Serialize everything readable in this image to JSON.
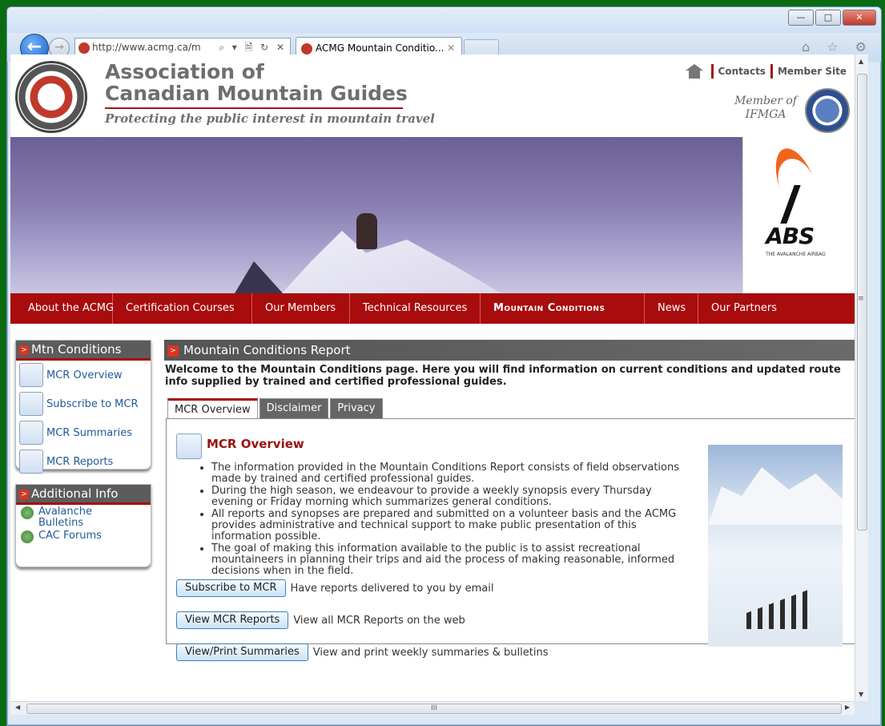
{
  "browser": {
    "address": "http://www.acmg.ca/m",
    "address_domain": "acmg.ca",
    "address_tools": "⌕ ▾ 🗎 ↻ ✕",
    "tab_title": "ACMG Mountain Conditio...",
    "tab_close": "✕",
    "win_min": "—",
    "win_max": "□",
    "win_close": "✕",
    "back": "←",
    "forward": "→",
    "ie_icons": "⌂ ☆ ⚙"
  },
  "header": {
    "org_line1": "Association of",
    "org_line2": "Canadian Mountain Guides",
    "tagline": "Protecting the public interest in mountain travel",
    "contacts": "Contacts",
    "member_site": "Member Site",
    "member_of_line1": "Member of",
    "member_of_line2": "IFMGA"
  },
  "ad": {
    "brand": "ABS",
    "sub": "THE AVALANCHE AIRBAG"
  },
  "nav": {
    "items": [
      "About the ACMG",
      "Certification Courses",
      "Our Members",
      "Technical Resources",
      "Mountain Conditions",
      "News",
      "Our Partners"
    ],
    "active_index": 4
  },
  "sidebar": {
    "mtn_head": "Mtn Conditions",
    "mtn_items": [
      "MCR Overview",
      "Subscribe to MCR",
      "MCR Summaries",
      "MCR Reports"
    ],
    "info_head": "Additional Info",
    "info_items": [
      "Avalanche Bulletins",
      "CAC Forums"
    ]
  },
  "main": {
    "panel_title": "Mountain Conditions Report",
    "welcome": "Welcome to the Mountain Conditions page. Here you will find information on current conditions and updated route info supplied by trained and certified professional guides.",
    "tabs": [
      "MCR Overview",
      "Disclaimer",
      "Privacy"
    ],
    "overview_title": "MCR Overview",
    "bullets": [
      "The information provided in the Mountain Conditions Report consists of field observations made by trained and certified professional guides.",
      "During the high season, we endeavour to provide a weekly synopsis every Thursday evening or Friday morning which summarizes general conditions.",
      "All reports and synopses are prepared and submitted on a volunteer basis and the ACMG provides administrative and technical support to make public presentation of this information possible.",
      "The goal of making this information available to the public is to assist recreational mountaineers in planning their trips and aid the process of making reasonable, informed decisions when in the field."
    ],
    "buttons": [
      {
        "label": "Subscribe to MCR",
        "desc": "Have reports delivered to you by email"
      },
      {
        "label": "View MCR Reports",
        "desc": "View all MCR Reports on the web"
      },
      {
        "label": "View/Print Summaries",
        "desc": "View and print weekly summaries & bulletins"
      }
    ]
  },
  "scrollbars": {
    "h_grip": "III",
    "v_grip": "≡"
  }
}
